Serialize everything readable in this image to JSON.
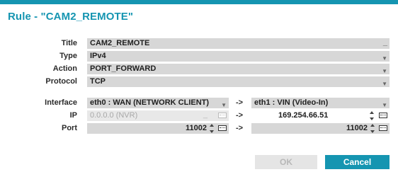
{
  "dialog": {
    "title": "Rule - \"CAM2_REMOTE\""
  },
  "labels": {
    "title": "Title",
    "type": "Type",
    "action": "Action",
    "protocol": "Protocol",
    "interface": "Interface",
    "ip": "IP",
    "port": "Port"
  },
  "fields": {
    "title_value": "CAM2_REMOTE",
    "type_value": "IPv4",
    "action_value": "PORT_FORWARD",
    "protocol_value": "TCP",
    "interface_src": "eth0 : WAN (NETWORK CLIENT)",
    "interface_dst": "eth1 : VIN (Video-In)",
    "ip_src_placeholder": "0.0.0.0 (NVR)",
    "ip_dst": "169.254.66.51",
    "port_src": "11002",
    "port_dst": "11002"
  },
  "arrows": {
    "interface": "->",
    "ip": "->",
    "port": "->"
  },
  "buttons": {
    "ok": "OK",
    "cancel": "Cancel"
  },
  "colors": {
    "accent": "#1595b1",
    "field_bg": "#d7d7d7",
    "disabled_field_bg": "#e8e8e8"
  },
  "icons": {
    "dropdown": "chevron-down-icon",
    "keyboard": "keyboard-icon",
    "spinner": "spinner-arrows-icon"
  }
}
